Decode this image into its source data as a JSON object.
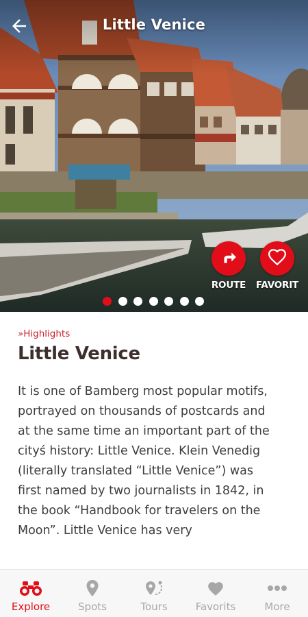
{
  "header": {
    "title": "Little Venice",
    "back_icon": "arrow-left-icon"
  },
  "actions": {
    "route": {
      "label": "ROUTE",
      "icon": "turn-right-arrow-icon"
    },
    "favorite": {
      "label": "FAVORIT",
      "icon": "heart-icon"
    }
  },
  "gallery": {
    "image_count": 7,
    "active_index": 0
  },
  "article": {
    "category": "»Highlights",
    "title": "Little Venice",
    "body": "It is one of Bamberg most popular motifs, portrayed on thousands of postcards and at the same time an important part of the cityś history: Little Venice. Klein Venedig (literally translated “Little Venice”) was first named by two journalists in 1842, in the book “Handbook for travelers on the Moon”. Little Venice has very"
  },
  "nav": {
    "items": [
      {
        "label": "Explore",
        "icon": "binoculars-icon",
        "active": true
      },
      {
        "label": "Spots",
        "icon": "map-pin-icon",
        "active": false
      },
      {
        "label": "Tours",
        "icon": "route-pin-icon",
        "active": false
      },
      {
        "label": "Favorits",
        "icon": "heart-icon",
        "active": false
      },
      {
        "label": "More",
        "icon": "dots-icon",
        "active": false
      }
    ]
  },
  "colors": {
    "accent": "#e10d18",
    "text_dark": "#3c2f2e",
    "body": "#3d3d3d",
    "nav_inactive": "#a7a7a7"
  }
}
